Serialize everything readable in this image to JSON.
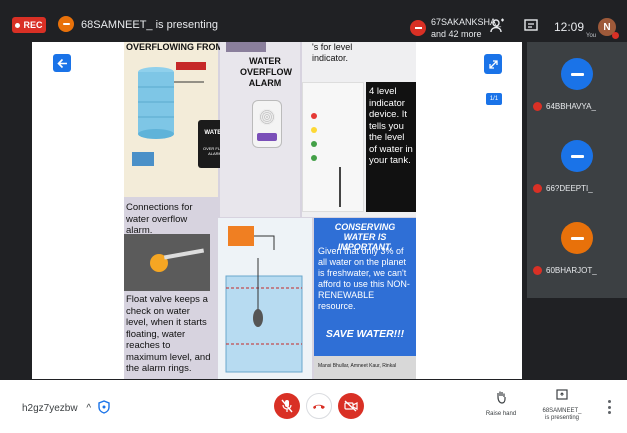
{
  "topbar": {
    "rec_label": "REC",
    "presenter_text": "68SAMNEET_ is presenting",
    "others_line1": "67SAKANKSHA_",
    "others_line2": "and 42 more",
    "clock": "12:09",
    "avatar_initial": "N",
    "you_label": "You"
  },
  "stage": {
    "page_indicator": "1/1"
  },
  "slide": {
    "top_left_title": "OVERFLOWING FROM",
    "top_right_snippet_1": "'s for level",
    "top_right_snippet_2": "indicator.",
    "alarm_title": [
      "WATER",
      "OVERFLOW",
      "ALARM"
    ],
    "water_tank_label_1": "WATER",
    "water_tank_label_2": "OVER FLOW ALARM",
    "connections_caption": "Connections for water overflow alarm.",
    "indicator_text": "4 level indicator device. It tells you the level of water in your tank.",
    "conserving_title": "CONSERVING WATER IS IMPORTANT.",
    "conserving_body": "Given that only 3% of all water on the planet is freshwater, we can't afford to use this NON-RENEWABLE resource.",
    "save_water": "SAVE WATER!!!",
    "authors": "Mansi Bhullar, Amneet Kaur, Rinkal",
    "float_caption": "Float valve keeps a check on water level, when it starts floating, water reaches to maximum level, and the alarm rings."
  },
  "participants": [
    {
      "name": "64BBHAVYA_",
      "color": "#1a73e8"
    },
    {
      "name": "66?DEEPTI_",
      "color": "#1a73e8"
    },
    {
      "name": "60BHARJOT_",
      "color": "#e8710a"
    }
  ],
  "bottombar": {
    "meeting_code": "h2gz7yezbw",
    "chevron": "^",
    "raise_hand_label": "Raise hand",
    "presenting_label_1": "68SAMNEET_",
    "presenting_label_2": "is presenting"
  },
  "colors": {
    "accent": "#1a73e8",
    "danger": "#d93025",
    "orange": "#e8710a"
  }
}
